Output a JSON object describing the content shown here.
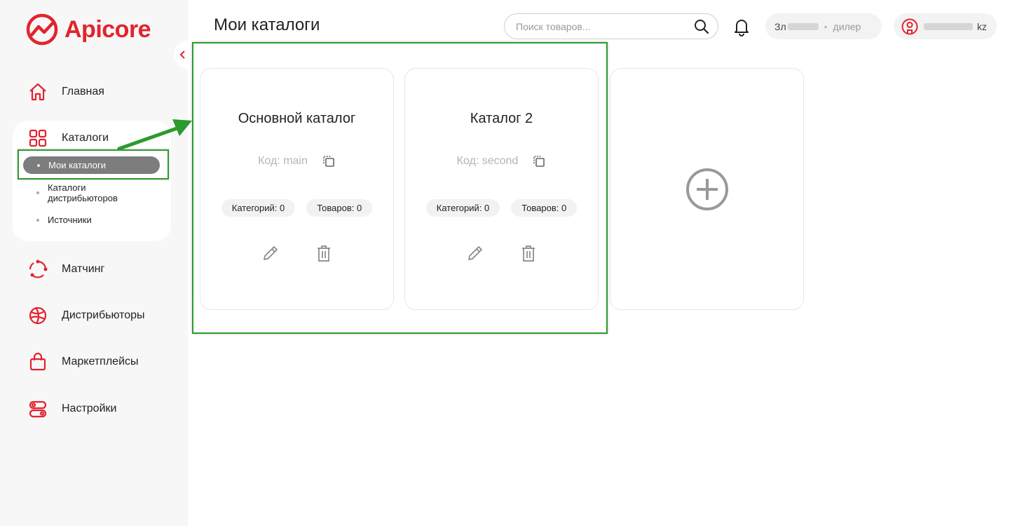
{
  "brand": {
    "name": "Apicore",
    "color": "#e3232c"
  },
  "header": {
    "title": "Мои каталоги",
    "search_placeholder": "Поиск товаров...",
    "user_name": "Зл",
    "user_role": "дилер",
    "user_email": "kz"
  },
  "sidebar": {
    "items": [
      {
        "label": "Главная",
        "icon": "home-icon"
      },
      {
        "label": "Каталоги",
        "icon": "grid-icon"
      },
      {
        "label": "Матчинг",
        "icon": "matching-icon"
      },
      {
        "label": "Дистрибьюторы",
        "icon": "globe-icon"
      },
      {
        "label": "Маркетплейсы",
        "icon": "shopping-bag-icon"
      },
      {
        "label": "Настройки",
        "icon": "settings-toggle-icon"
      }
    ],
    "catalog_sub": [
      {
        "label": "Мои каталоги",
        "active": true
      },
      {
        "label": "Каталоги дистрибьюторов"
      },
      {
        "label": "Источники"
      }
    ]
  },
  "catalogs": [
    {
      "title": "Основной каталог",
      "code_label": "Код: main",
      "categories": "Категорий: 0",
      "products": "Товаров: 0"
    },
    {
      "title": "Каталог 2",
      "code_label": "Код: second",
      "categories": "Категорий: 0",
      "products": "Товаров: 0"
    }
  ],
  "colors": {
    "highlight": "#2c9a2c",
    "accent": "#e3232c",
    "active_sub": "#7d7d7d"
  }
}
